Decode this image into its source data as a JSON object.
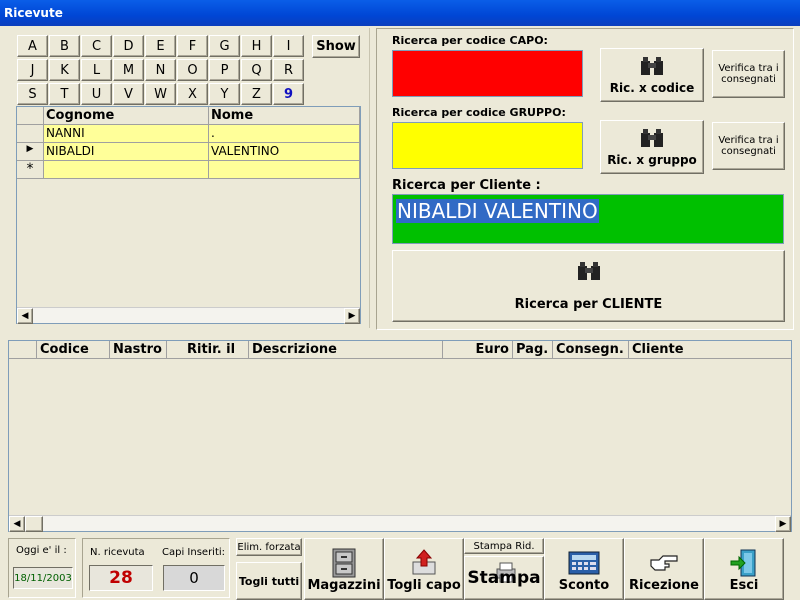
{
  "window": {
    "title": "Ricevute"
  },
  "letters": [
    "A",
    "B",
    "C",
    "D",
    "E",
    "F",
    "G",
    "H",
    "I",
    "J",
    "K",
    "L",
    "M",
    "N",
    "O",
    "P",
    "Q",
    "R",
    "S",
    "T",
    "U",
    "V",
    "W",
    "X",
    "Y",
    "Z",
    "9"
  ],
  "show_label": "Show",
  "client_grid": {
    "headers": [
      "Cognome",
      "Nome"
    ],
    "rows": [
      {
        "cognome": "NANNI",
        "nome": "."
      },
      {
        "cognome": "NIBALDI",
        "nome": "VALENTINO"
      },
      {
        "cognome": "",
        "nome": ""
      }
    ],
    "current_marker": "▶",
    "new_marker": "*"
  },
  "search": {
    "capo_label": "Ricerca per codice CAPO:",
    "capo_color": "#FF0000",
    "gruppo_label": "Ricerca per codice GRUPPO:",
    "gruppo_color": "#FFFF00",
    "btn_codice": "Ric. x codice",
    "btn_gruppo": "Ric. x gruppo",
    "verifica_1": "Verifica tra i consegnati",
    "verifica_2": "Verifica tra i consegnati",
    "cliente_label": "Ricerca per Cliente :",
    "cliente_value": "NIBALDI VALENTINO",
    "cliente_color": "#00C000",
    "btn_cliente": "Ricerca per CLIENTE"
  },
  "items_table": {
    "headers": [
      "Codice",
      "Nastro",
      "Ritir. il",
      "Descrizione",
      "Euro",
      "Pag.",
      "Consegn.",
      "Cliente"
    ]
  },
  "footer": {
    "oggi_label": "Oggi e' il :",
    "oggi_value": "18/11/2003",
    "nricevuta_label": "N. ricevuta",
    "nricevuta_value": "28",
    "capi_label": "Capi Inseriti:",
    "capi_value": "0",
    "elim_forzata": "Elim. forzata",
    "togli_tutti": "Togli tutti",
    "stampa_rid": "Stampa Rid.",
    "buttons": {
      "magazzini": "Magazzini",
      "togli_capo": "Togli capo",
      "stampa": "Stampa",
      "sconto": "Sconto",
      "ricezione": "Ricezione",
      "esci": "Esci"
    }
  }
}
